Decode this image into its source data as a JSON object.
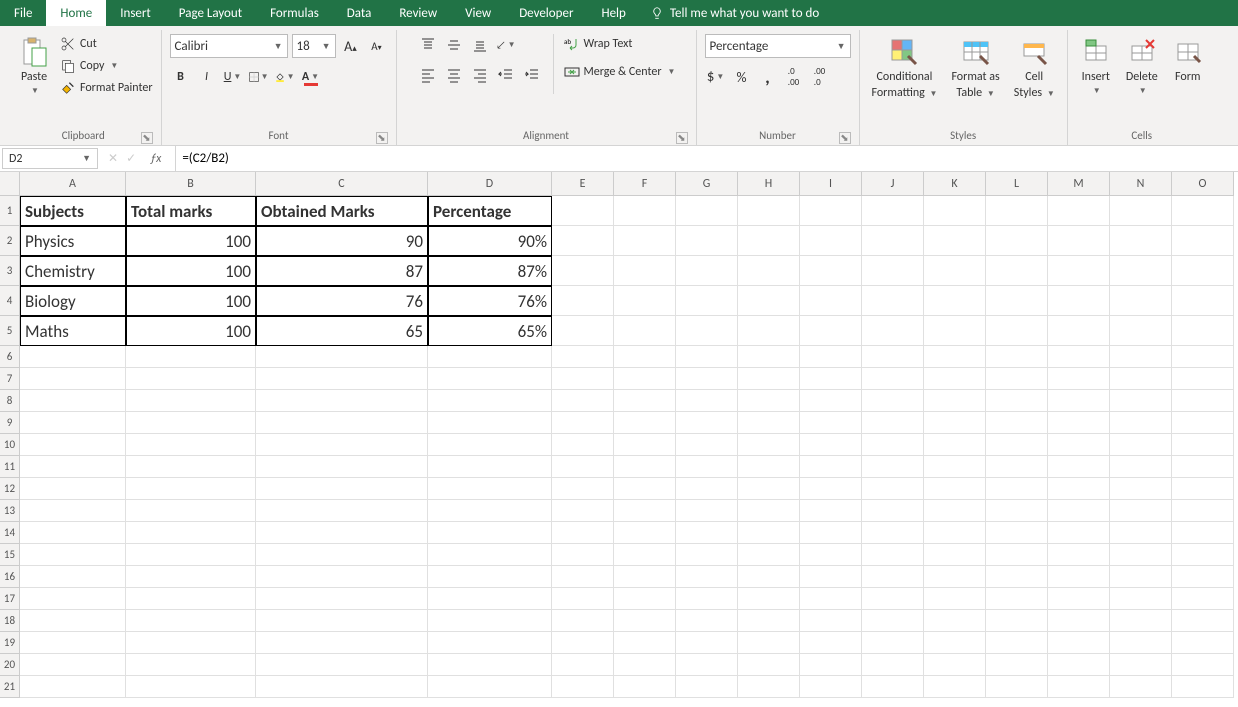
{
  "tabs": {
    "file": "File",
    "home": "Home",
    "insert": "Insert",
    "pagelayout": "Page Layout",
    "formulas": "Formulas",
    "data": "Data",
    "review": "Review",
    "view": "View",
    "developer": "Developer",
    "help": "Help",
    "tellme": "Tell me what you want to do"
  },
  "clipboard": {
    "paste": "Paste",
    "cut": "Cut",
    "copy": "Copy",
    "fmtpainter": "Format Painter",
    "label": "Clipboard"
  },
  "font": {
    "name": "Calibri",
    "size": "18",
    "label": "Font"
  },
  "alignment": {
    "wrap": "Wrap Text",
    "merge": "Merge & Center",
    "label": "Alignment"
  },
  "number": {
    "format": "Percentage",
    "label": "Number"
  },
  "styles": {
    "cond": "Conditional",
    "cond2": "Formatting",
    "fat": "Format as",
    "fat2": "Table",
    "cell": "Cell",
    "cell2": "Styles",
    "label": "Styles"
  },
  "cells": {
    "insert": "Insert",
    "delete": "Delete",
    "format": "Form",
    "label": "Cells"
  },
  "namebox": "D2",
  "formula": "=(C2/B2)",
  "columns": [
    "A",
    "B",
    "C",
    "D",
    "E",
    "F",
    "G",
    "H",
    "I",
    "J",
    "K",
    "L",
    "M",
    "N",
    "O"
  ],
  "headers": {
    "A": "Subjects",
    "B": "Total marks",
    "C": "Obtained Marks",
    "D": "Percentage"
  },
  "rows": [
    {
      "A": "Physics",
      "B": "100",
      "C": "90",
      "D": "90%"
    },
    {
      "A": "Chemistry",
      "B": "100",
      "C": "87",
      "D": "87%"
    },
    {
      "A": "Biology",
      "B": "100",
      "C": "76",
      "D": "76%"
    },
    {
      "A": "Maths",
      "B": "100",
      "C": "65",
      "D": "65%"
    }
  ],
  "rownums": [
    "1",
    "2",
    "3",
    "4",
    "5",
    "6",
    "7",
    "8",
    "9",
    "10",
    "11",
    "12",
    "13",
    "14",
    "15",
    "16",
    "17",
    "18",
    "19",
    "20",
    "21"
  ]
}
